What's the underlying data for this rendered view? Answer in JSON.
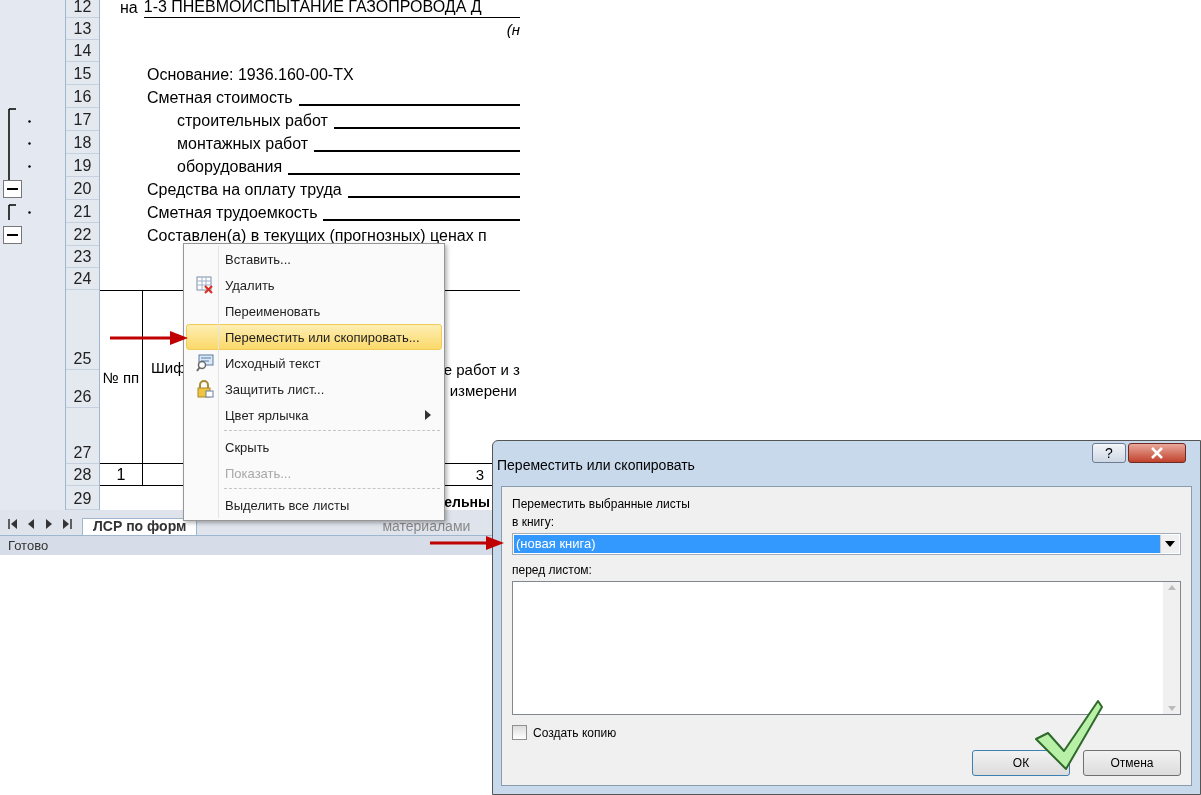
{
  "sheet": {
    "rows": [
      "12",
      "13",
      "14",
      "15",
      "16",
      "17",
      "18",
      "19",
      "20",
      "21",
      "22",
      "23",
      "24",
      "25",
      "26",
      "27",
      "28",
      "29"
    ],
    "lines": [
      {
        "kind": "title",
        "text": "на",
        "value": "1-3 ПНЕВМОИСПЫТАНИЕ ГАЗОПРОВОДА Д"
      },
      {
        "kind": "note",
        "text": "(н"
      },
      {
        "kind": "blank"
      },
      {
        "kind": "text",
        "text": "Основание: 1936.160-00-ТХ"
      },
      {
        "kind": "field",
        "text": "Сметная стоимость"
      },
      {
        "kind": "subfield",
        "text": "строительных работ"
      },
      {
        "kind": "subfield",
        "text": "монтажных работ"
      },
      {
        "kind": "subfield",
        "text": "оборудования"
      },
      {
        "kind": "field",
        "text": "Средства на оплату труда"
      },
      {
        "kind": "field",
        "text": "Сметная трудоемкость"
      },
      {
        "kind": "text",
        "text": "Составлен(а) в текущих (прогнозных) ценах п"
      },
      {
        "kind": "blank"
      }
    ],
    "header": {
      "col_1": "№ пп",
      "col_2": "Шиф",
      "col_3_line_1": "е работ и з",
      "col_3_line_2": "измерени"
    },
    "row_28": {
      "col_1": "1",
      "col_3": "3"
    },
    "row_29": {
      "col_3": "ельны"
    },
    "tabs": [
      {
        "label": "ЛСР по форм",
        "selected": true
      },
      {
        "label": "материалами",
        "selected": false
      }
    ],
    "status": "Готово"
  },
  "context_menu": [
    {
      "kind": "plain",
      "label": "Вставить...",
      "selected": false,
      "disabled": false,
      "submenu": false,
      "separator_before": false
    },
    {
      "kind": "delete",
      "label": "Удалить",
      "selected": false,
      "disabled": false,
      "submenu": false,
      "separator_before": false
    },
    {
      "kind": "plain",
      "label": "Переименовать",
      "selected": false,
      "disabled": false,
      "submenu": false,
      "separator_before": false
    },
    {
      "kind": "plain",
      "label": "Переместить или скопировать...",
      "selected": true,
      "disabled": false,
      "submenu": false,
      "separator_before": false
    },
    {
      "kind": "source",
      "label": "Исходный текст",
      "selected": false,
      "disabled": false,
      "submenu": false,
      "separator_before": false
    },
    {
      "kind": "protect",
      "label": "Защитить лист...",
      "selected": false,
      "disabled": false,
      "submenu": false,
      "separator_before": false
    },
    {
      "kind": "plain",
      "label": "Цвет ярлычка",
      "selected": false,
      "disabled": false,
      "submenu": true,
      "separator_before": false
    },
    {
      "kind": "plain",
      "label": "Скрыть",
      "selected": false,
      "disabled": false,
      "submenu": false,
      "separator_before": true
    },
    {
      "kind": "plain",
      "label": "Показать...",
      "selected": false,
      "disabled": true,
      "submenu": false,
      "separator_before": false
    },
    {
      "kind": "plain",
      "label": "Выделить все листы",
      "selected": false,
      "disabled": false,
      "submenu": false,
      "separator_before": true
    }
  ],
  "dialog": {
    "title": "Переместить или скопировать",
    "help": "?",
    "caption": "Переместить выбранные листы",
    "book_label": "в книгу:",
    "book_value": "(новая книга)",
    "before_label": "перед листом:",
    "copy": {
      "label": "Создать копию",
      "checked": false
    },
    "buttons": [
      "ОК",
      "Отмена"
    ]
  }
}
